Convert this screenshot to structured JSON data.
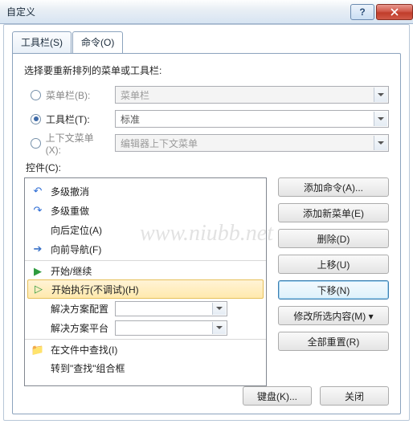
{
  "titlebar": {
    "title": "自定义"
  },
  "tabs": {
    "toolbars": "工具栏(S)",
    "commands": "命令(O)"
  },
  "heading": "选择要重新排列的菜单或工具栏:",
  "rows": {
    "menubar": {
      "label": "菜单栏(B):",
      "value": "菜单栏"
    },
    "toolbar": {
      "label": "工具栏(T):",
      "value": "标准"
    },
    "context": {
      "label": "上下文菜单(X):",
      "value": "编辑器上下文菜单"
    }
  },
  "controlsLabel": "控件(C):",
  "items": {
    "multiUndo": "多级撤消",
    "multiRedo": "多级重做",
    "navBack": "向后定位(A)",
    "navFwd": "向前导航(F)",
    "start": "开始/继续",
    "startNoDbg": "开始执行(不调试)(H)",
    "slnConfig": "解决方案配置",
    "slnPlatform": "解决方案平台",
    "findInFiles": "在文件中查找(I)",
    "gotoFind": "转到\"查找\"组合框"
  },
  "buttons": {
    "addCmd": "添加命令(A)...",
    "addMenu": "添加新菜单(E)",
    "delete": "删除(D)",
    "moveUp": "上移(U)",
    "moveDown": "下移(N)",
    "modifySel": "修改所选内容(M) ▾",
    "resetAll": "全部重置(R)"
  },
  "footer": {
    "keyboard": "键盘(K)...",
    "close": "关闭"
  },
  "watermark": "www.niubb.net"
}
